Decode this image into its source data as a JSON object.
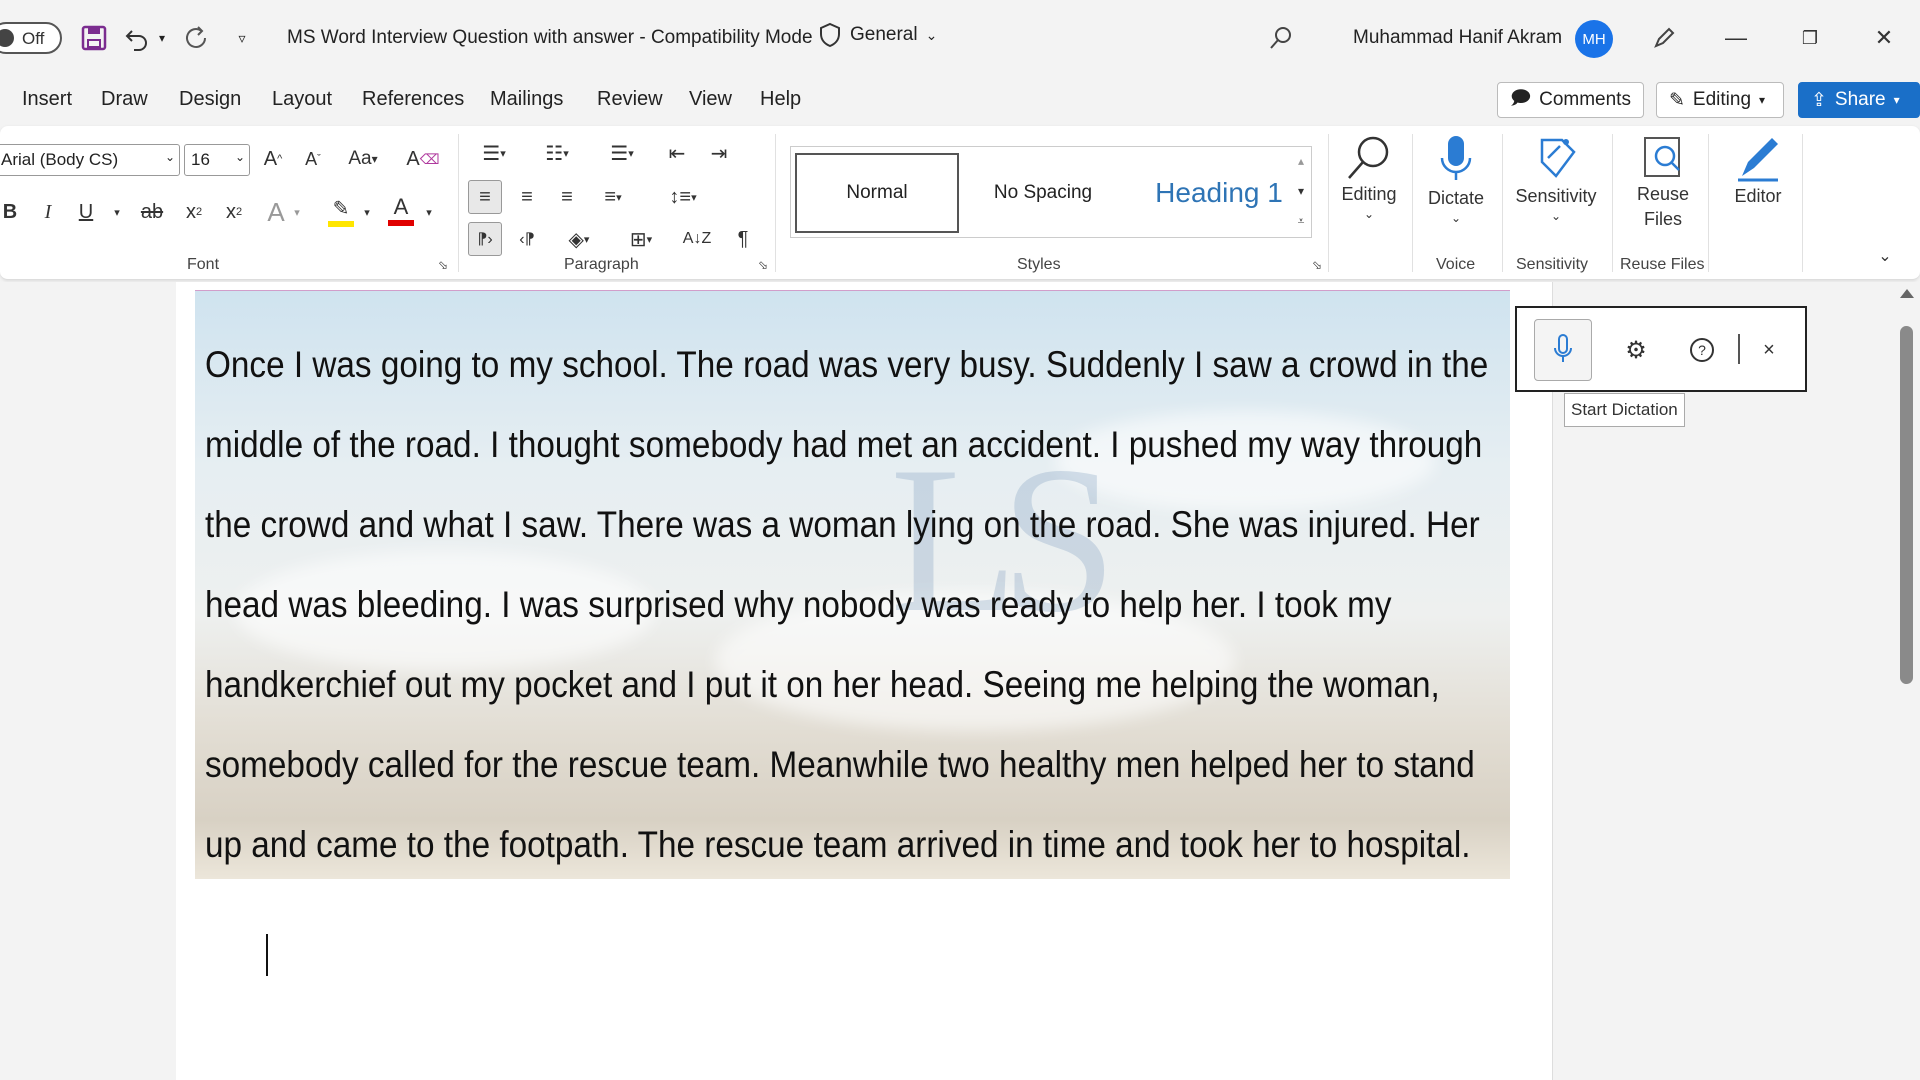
{
  "titlebar": {
    "autosave_state": "Off",
    "doc_title": "MS Word Interview Question with answer  -  Compatibility Mode",
    "sensitivity_label": "General",
    "user_name": "Muhammad Hanif Akram",
    "user_initials": "MH"
  },
  "menu": {
    "tabs": [
      "Insert",
      "Draw",
      "Design",
      "Layout",
      "References",
      "Mailings",
      "Review",
      "View",
      "Help"
    ],
    "comments_label": "Comments",
    "editing_label": "Editing",
    "share_label": "Share"
  },
  "ribbon": {
    "font_name": "Arial (Body CS)",
    "font_size": "16",
    "groups": {
      "font": "Font",
      "paragraph": "Paragraph",
      "styles": "Styles",
      "voice": "Voice",
      "sensitivity": "Sensitivity",
      "reuse": "Reuse Files"
    },
    "styles": {
      "normal": "Normal",
      "no_spacing": "No Spacing",
      "heading1": "Heading 1"
    },
    "buttons": {
      "editing": "Editing",
      "dictate": "Dictate",
      "sensitivity": "Sensitivity",
      "reuse_line1": "Reuse",
      "reuse_line2": "Files",
      "editor": "Editor"
    },
    "colors": {
      "highlight": "#ffe600",
      "font_color": "#e00000",
      "heading": "#2e74b5",
      "share": "#1a6fc8"
    }
  },
  "document": {
    "lines": [
      "Once I was going to my school. The road was very busy. Suddenly I saw a crowd in the",
      "middle of the road. I thought somebody had met an accident. I pushed my way through",
      "the crowd and what I saw. There was a woman lying on the road. She was injured. Her",
      "head was bleeding. I was surprised why nobody was ready to help her. I took my",
      "handkerchief out my pocket and I put it on her head. Seeing me helping the woman,",
      "somebody called for the rescue team. Meanwhile two healthy men helped her to stand",
      "up and came to the footpath. The rescue team arrived in time and took her to hospital."
    ],
    "watermark": "LS"
  },
  "dictation": {
    "tooltip": "Start Dictation"
  }
}
